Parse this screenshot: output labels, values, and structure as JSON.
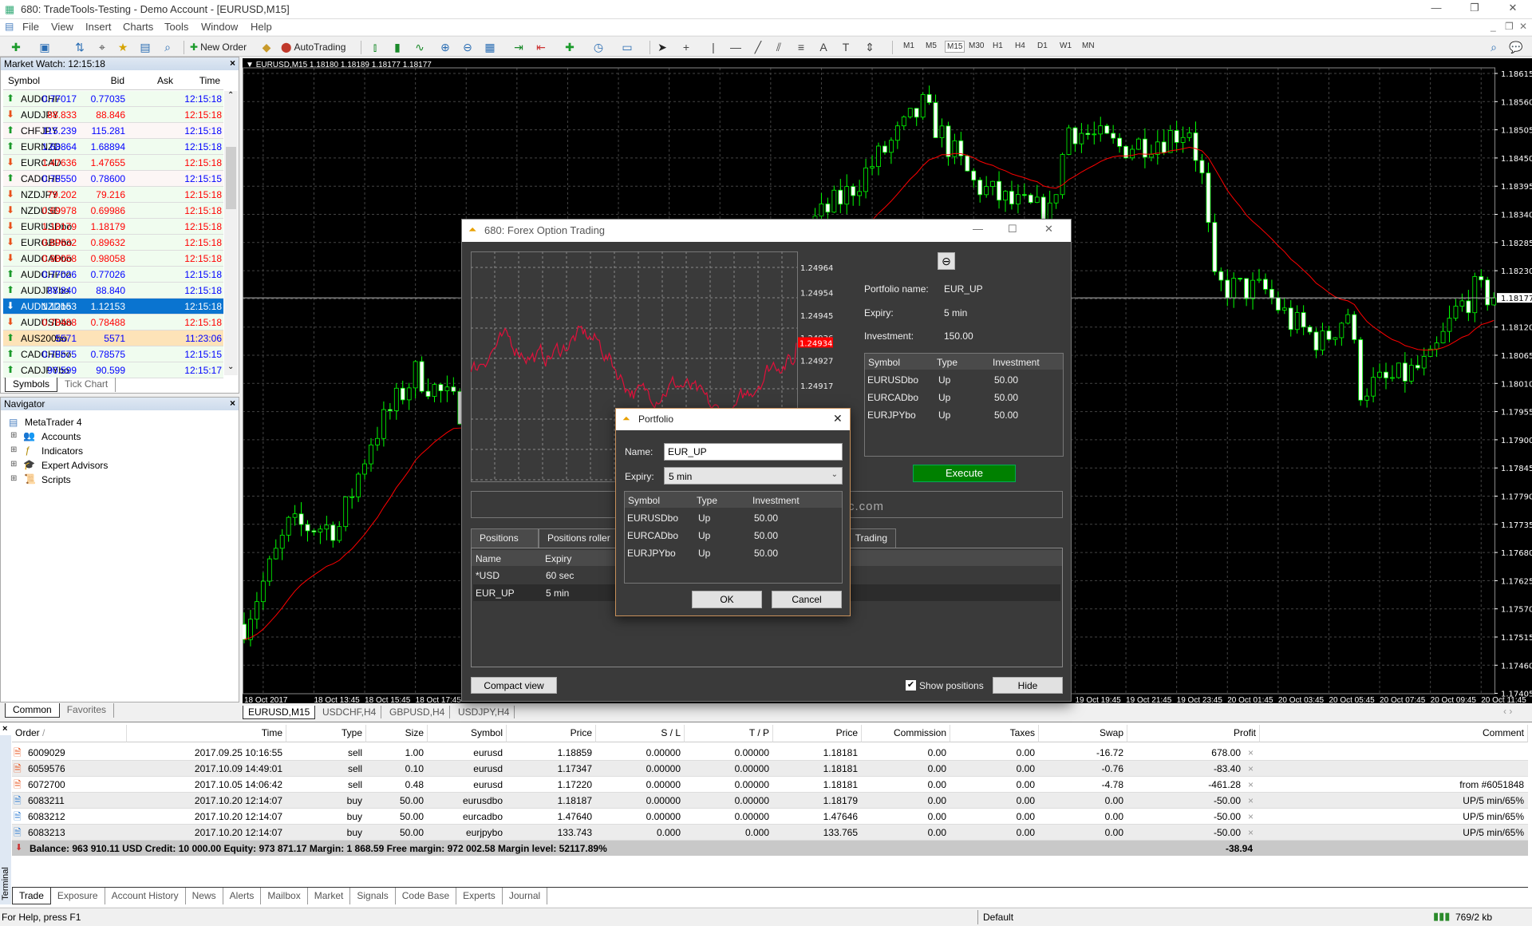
{
  "window": {
    "title": "680: TradeTools-Testing - Demo Account - [EURUSD,M15]"
  },
  "menu": [
    "File",
    "View",
    "Insert",
    "Charts",
    "Tools",
    "Window",
    "Help"
  ],
  "toolbar": {
    "new_order": "New Order",
    "autotrading": "AutoTrading",
    "timeframes": [
      "M1",
      "M5",
      "M15",
      "M30",
      "H1",
      "H4",
      "D1",
      "W1",
      "MN"
    ],
    "active_timeframe": "M15"
  },
  "market_watch": {
    "title": "Market Watch: 12:15:18",
    "columns": [
      "Symbol",
      "Bid",
      "Ask",
      "Time"
    ],
    "rows": [
      {
        "symbol": "AUDCHF",
        "bid": "0.77017",
        "ask": "0.77035",
        "time": "12:15:18",
        "dir": "up"
      },
      {
        "symbol": "AUDJPY",
        "bid": "88.833",
        "ask": "88.846",
        "time": "12:15:18",
        "dir": "down"
      },
      {
        "symbol": "CHFJPY",
        "bid": "115.239",
        "ask": "115.281",
        "time": "12:15:18",
        "dir": "up"
      },
      {
        "symbol": "EURNZD",
        "bid": "1.68864",
        "ask": "1.68894",
        "time": "12:15:18",
        "dir": "up"
      },
      {
        "symbol": "EURCAD",
        "bid": "1.47636",
        "ask": "1.47655",
        "time": "12:15:18",
        "dir": "down"
      },
      {
        "symbol": "CADCHF",
        "bid": "0.78550",
        "ask": "0.78600",
        "time": "12:15:15",
        "dir": "up"
      },
      {
        "symbol": "NZDJPY",
        "bid": "79.202",
        "ask": "79.216",
        "time": "12:15:18",
        "dir": "down"
      },
      {
        "symbol": "NZDUSD",
        "bid": "0.69978",
        "ask": "0.69986",
        "time": "12:15:18",
        "dir": "down"
      },
      {
        "symbol": "EURUSDbo",
        "bid": "1.18179",
        "ask": "1.18179",
        "time": "12:15:18",
        "dir": "down"
      },
      {
        "symbol": "EURGBPbo",
        "bid": "0.89632",
        "ask": "0.89632",
        "time": "12:15:18",
        "dir": "down"
      },
      {
        "symbol": "AUDCADbo",
        "bid": "0.98058",
        "ask": "0.98058",
        "time": "12:15:18",
        "dir": "down"
      },
      {
        "symbol": "AUDCHFbo",
        "bid": "0.77026",
        "ask": "0.77026",
        "time": "12:15:18",
        "dir": "up"
      },
      {
        "symbol": "AUDJPYbo",
        "bid": "88.840",
        "ask": "88.840",
        "time": "12:15:18",
        "dir": "up"
      },
      {
        "symbol": "AUDNZDbo",
        "bid": "1.12153",
        "ask": "1.12153",
        "time": "12:15:18",
        "dir": "down",
        "selected": true
      },
      {
        "symbol": "AUDUSDbo",
        "bid": "0.78488",
        "ask": "0.78488",
        "time": "12:15:18",
        "dir": "down"
      },
      {
        "symbol": "AUS200bo",
        "bid": "5571",
        "ask": "5571",
        "time": "11:23:06",
        "dir": "up",
        "stale": true
      },
      {
        "symbol": "CADCHFbo",
        "bid": "0.78575",
        "ask": "0.78575",
        "time": "12:15:15",
        "dir": "up"
      },
      {
        "symbol": "CADJPYbo",
        "bid": "90.599",
        "ask": "90.599",
        "time": "12:15:17",
        "dir": "up"
      }
    ],
    "tabs": [
      "Symbols",
      "Tick Chart"
    ]
  },
  "navigator": {
    "title": "Navigator",
    "root": "MetaTrader 4",
    "items": [
      "Accounts",
      "Indicators",
      "Expert Advisors",
      "Scripts"
    ],
    "tabs": [
      "Common",
      "Favorites"
    ]
  },
  "chart": {
    "header": "EURUSD,M15  1.18180 1.18189 1.18177 1.18177",
    "current_price": "1.18177",
    "price_labels": [
      "1.18615",
      "1.18560",
      "1.18505",
      "1.18450",
      "1.18395",
      "1.18340",
      "1.18285",
      "1.18230",
      "1.18120",
      "1.18065",
      "1.18010",
      "1.17955",
      "1.17900",
      "1.17845",
      "1.17790",
      "1.17735",
      "1.17680",
      "1.17625",
      "1.17570",
      "1.17515",
      "1.17460",
      "1.17405"
    ],
    "time_labels": [
      "18 Oct 2017",
      "18 Oct 13:45",
      "18 Oct 15:45",
      "18 Oct 17:45",
      "19 Oct 19:45",
      "19 Oct 21:45",
      "19 Oct 23:45",
      "20 Oct 01:45",
      "20 Oct 03:45",
      "20 Oct 05:45",
      "20 Oct 07:45",
      "20 Oct 09:45",
      "20 Oct 11:45"
    ],
    "price_path": [
      [
        "18 Oct 11:00",
        1.1754
      ],
      [
        "18 Oct 12:45",
        1.1773
      ],
      [
        "18 Oct 14:45",
        1.1773
      ],
      [
        "18 Oct 16:00",
        1.179
      ],
      [
        "18 Oct 17:45",
        1.1803
      ],
      [
        "18 Oct 19:30",
        1.1796
      ],
      [
        "19 Oct 02:00",
        1.1805
      ],
      [
        "19 Oct 07:00",
        1.1822
      ],
      [
        "19 Oct 10:45",
        1.1838
      ],
      [
        "19 Oct 13:45",
        1.1855
      ],
      [
        "19 Oct 15:45",
        1.184
      ],
      [
        "19 Oct 17:15",
        1.1836
      ],
      [
        "19 Oct 18:45",
        1.1834
      ],
      [
        "19 Oct 19:30",
        1.1851
      ],
      [
        "19 Oct 21:30",
        1.1847
      ],
      [
        "19 Oct 23:15",
        1.1849
      ],
      [
        "20 Oct 00:15",
        1.1851
      ],
      [
        "20 Oct 00:45",
        1.1841
      ],
      [
        "20 Oct 01:15",
        1.182
      ],
      [
        "20 Oct 03:15",
        1.1819
      ],
      [
        "20 Oct 04:15",
        1.1813
      ],
      [
        "20 Oct 05:30",
        1.1809
      ],
      [
        "20 Oct 06:30",
        1.1815
      ],
      [
        "20 Oct 07:00",
        1.18
      ],
      [
        "20 Oct 08:30",
        1.1802
      ],
      [
        "20 Oct 09:45",
        1.1805
      ],
      [
        "20 Oct 10:45",
        1.1815
      ],
      [
        "20 Oct 11:30",
        1.1819
      ],
      [
        "20 Oct 12:15",
        1.18177
      ]
    ],
    "tabs": [
      "EURUSD,M15",
      "USDCHF,H4",
      "GBPUSD,H4",
      "USDJPY,H4"
    ],
    "colors": {
      "background": "#000000",
      "candle": "#00ff00",
      "ma": "#ff0000"
    }
  },
  "option_dialog": {
    "title": "680: Forex Option Trading",
    "mini_chart": {
      "labels": [
        "1.24964",
        "1.24954",
        "1.24945",
        "1.24936",
        "1.24927",
        "1.24917"
      ],
      "current": "1.24934"
    },
    "portfolio_name_label": "Portfolio name:",
    "portfolio_name": "EUR_UP",
    "expiry_label": "Expiry:",
    "expiry": "5 min",
    "investment_label": "Investment:",
    "investment": "150.00",
    "table_columns": [
      "Symbol",
      "Type",
      "Investment"
    ],
    "table_rows": [
      [
        "EURUSDbo",
        "Up",
        "50.00"
      ],
      [
        "EURCADbo",
        "Up",
        "50.00"
      ],
      [
        "EURJPYbo",
        "Up",
        "50.00"
      ]
    ],
    "execute": "Execute",
    "banner_text": "c.com",
    "tabs": [
      "Positions",
      "Positions roller",
      "Trading"
    ],
    "positions_columns": [
      "Name",
      "Expiry"
    ],
    "positions_rows": [
      [
        "*USD",
        "60 sec"
      ],
      [
        "EUR_UP",
        "5 min"
      ]
    ],
    "compact_view": "Compact view",
    "show_positions": "Show positions",
    "show_positions_checked": true,
    "hide": "Hide"
  },
  "portfolio_dialog": {
    "title": "Portfolio",
    "name_label": "Name:",
    "name_value": "EUR_UP",
    "expiry_label": "Expiry:",
    "expiry_value": "5 min",
    "table_columns": [
      "Symbol",
      "Type",
      "Investment"
    ],
    "table_rows": [
      [
        "EURUSDbo",
        "Up",
        "50.00"
      ],
      [
        "EURCADbo",
        "Up",
        "50.00"
      ],
      [
        "EURJPYbo",
        "Up",
        "50.00"
      ]
    ],
    "ok": "OK",
    "cancel": "Cancel"
  },
  "terminal": {
    "side_label": "Terminal",
    "columns": [
      "Order",
      "Time",
      "Type",
      "Size",
      "Symbol",
      "Price",
      "S / L",
      "T / P",
      "Price",
      "Commission",
      "Taxes",
      "Swap",
      "Profit",
      "Comment"
    ],
    "rows": [
      {
        "order": "6009029",
        "time": "2017.09.25 10:16:55",
        "type": "sell",
        "size": "1.00",
        "symbol": "eurusd",
        "price": "1.18859",
        "sl": "0.00000",
        "tp": "0.00000",
        "cur": "1.18181",
        "commission": "0.00",
        "taxes": "0.00",
        "swap": "-16.72",
        "profit": "678.00",
        "comment": ""
      },
      {
        "order": "6059576",
        "time": "2017.10.09 14:49:01",
        "type": "sell",
        "size": "0.10",
        "symbol": "eurusd",
        "price": "1.17347",
        "sl": "0.00000",
        "tp": "0.00000",
        "cur": "1.18181",
        "commission": "0.00",
        "taxes": "0.00",
        "swap": "-0.76",
        "profit": "-83.40",
        "comment": ""
      },
      {
        "order": "6072700",
        "time": "2017.10.05 14:06:42",
        "type": "sell",
        "size": "0.48",
        "symbol": "eurusd",
        "price": "1.17220",
        "sl": "0.00000",
        "tp": "0.00000",
        "cur": "1.18181",
        "commission": "0.00",
        "taxes": "0.00",
        "swap": "-4.78",
        "profit": "-461.28",
        "comment": "from #6051848"
      },
      {
        "order": "6083211",
        "time": "2017.10.20 12:14:07",
        "type": "buy",
        "size": "50.00",
        "symbol": "eurusdbo",
        "price": "1.18187",
        "sl": "0.00000",
        "tp": "0.00000",
        "cur": "1.18179",
        "commission": "0.00",
        "taxes": "0.00",
        "swap": "0.00",
        "profit": "-50.00",
        "comment": "UP/5 min/65%"
      },
      {
        "order": "6083212",
        "time": "2017.10.20 12:14:07",
        "type": "buy",
        "size": "50.00",
        "symbol": "eurcadbo",
        "price": "1.47640",
        "sl": "0.00000",
        "tp": "0.00000",
        "cur": "1.47646",
        "commission": "0.00",
        "taxes": "0.00",
        "swap": "0.00",
        "profit": "-50.00",
        "comment": "UP/5 min/65%"
      },
      {
        "order": "6083213",
        "time": "2017.10.20 12:14:07",
        "type": "buy",
        "size": "50.00",
        "symbol": "eurjpybo",
        "price": "133.743",
        "sl": "0.000",
        "tp": "0.000",
        "cur": "133.765",
        "commission": "0.00",
        "taxes": "0.00",
        "swap": "0.00",
        "profit": "-50.00",
        "comment": "UP/5 min/65%"
      }
    ],
    "summary": "Balance: 963 910.11 USD  Credit: 10 000.00  Equity: 973 871.17  Margin: 1 868.59  Free margin: 972 002.58  Margin level: 52117.89%",
    "total_profit": "-38.94",
    "tabs": [
      "Trade",
      "Exposure",
      "Account History",
      "News",
      "Alerts",
      "Mailbox",
      "Market",
      "Signals",
      "Code Base",
      "Experts",
      "Journal"
    ]
  },
  "status": {
    "help": "For Help, press F1",
    "profile": "Default",
    "traffic": "769/2 kb"
  }
}
